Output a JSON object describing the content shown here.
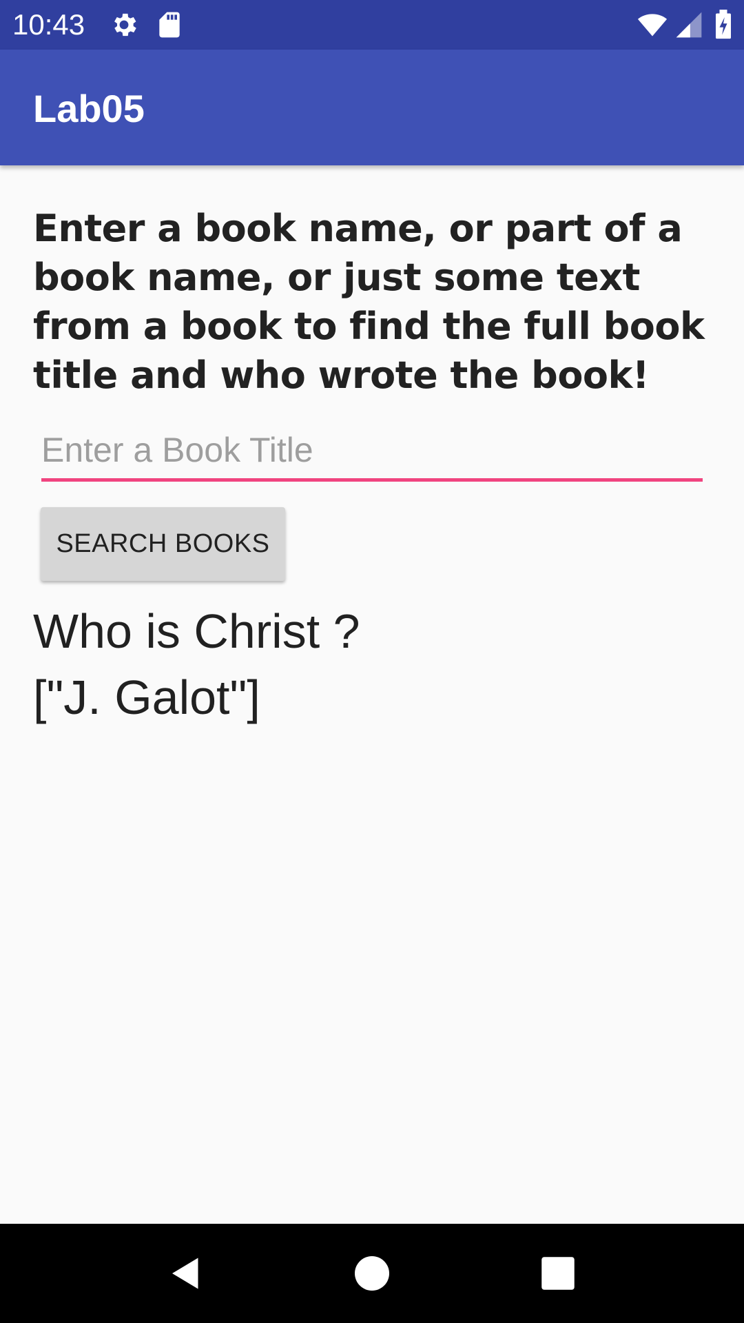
{
  "status_bar": {
    "time": "10:43",
    "icons": [
      "gear-icon",
      "sd-card-icon",
      "wifi-icon",
      "signal-icon",
      "battery-charging-icon"
    ],
    "background": "#303f9f"
  },
  "app_bar": {
    "title": "Lab05",
    "background": "#3f51b5"
  },
  "main": {
    "instructions": "Enter a book name, or part of a book name, or just some text from a book to find the full book title and who wrote the book!",
    "search_input": {
      "placeholder": "Enter a Book Title",
      "value": "",
      "underline_color": "#f0447f"
    },
    "search_button_label": "SEARCH BOOKS",
    "result": {
      "title": "Who is Christ ?",
      "authors": "[\"J. Galot\"]"
    }
  },
  "nav_bar": {
    "buttons": [
      "back-icon",
      "home-icon",
      "recents-icon"
    ]
  }
}
